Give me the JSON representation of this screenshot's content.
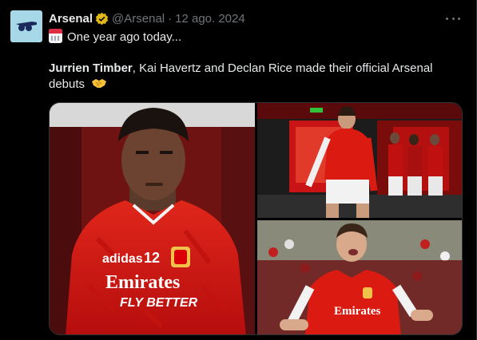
{
  "tweet": {
    "author_name": "Arsenal",
    "author_handle": "@Arsenal",
    "separator": "·",
    "date": "12 ago. 2024",
    "line1": "One year ago today...",
    "line2_bold": "Jurrien Timber",
    "line2_rest": ", Kai Havertz and Declan Rice made their official Arsenal",
    "line3": "debuts"
  },
  "media": {
    "shirt_sponsor_top": "Emirates",
    "shirt_sponsor_bottom": "FLY BETTER",
    "shirt_number": "12"
  },
  "colors": {
    "background": "#000000",
    "text": "#e7e9ea",
    "muted": "#71767b",
    "verified_gold": "#e2b719",
    "arsenal_red": "#db0007"
  },
  "icons": {
    "avatar": "arsenal-cannon-icon",
    "verified": "verified-badge-icon",
    "more": "more-options-icon",
    "calendar": "calendar-emoji-icon",
    "handshake": "handshake-emoji-icon"
  }
}
